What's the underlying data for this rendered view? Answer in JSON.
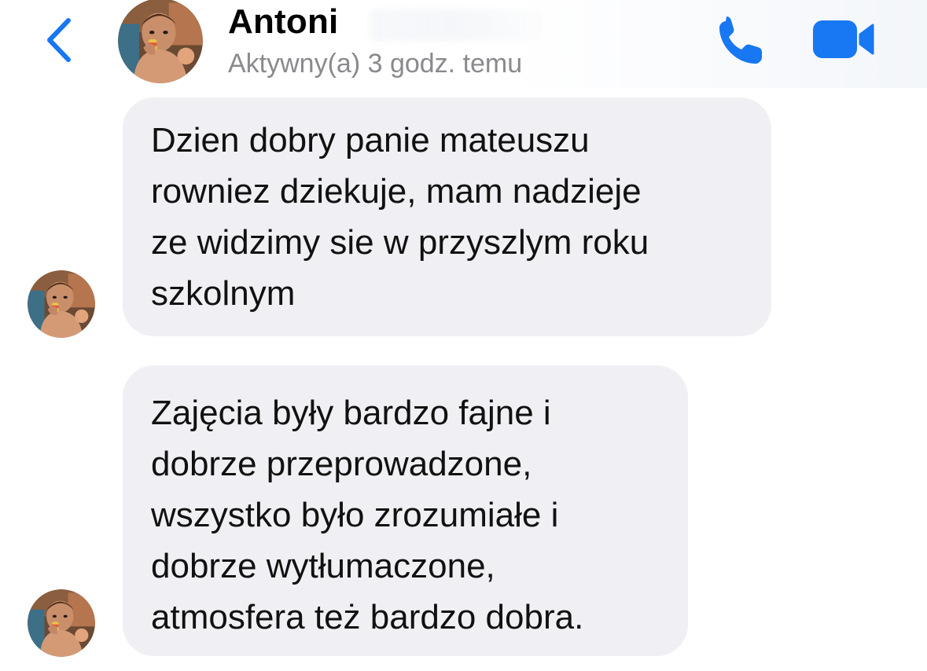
{
  "header": {
    "contact_name": "Antoni",
    "status": "Aktywny(a) 3 godz. temu",
    "back_icon": "chevron-left-icon",
    "call_icon": "phone-icon",
    "video_icon": "video-camera-icon",
    "accent_color": "#1877f2"
  },
  "messages": [
    {
      "lines": [
        "Dzien dobry panie mateuszu",
        "rowniez dziekuje, mam nadzieje",
        "ze widzimy sie w przyszlym roku",
        "szkolnym"
      ]
    },
    {
      "lines": [
        "Zajęcia były bardzo fajne i",
        "dobrze przeprowadzone,",
        "wszystko było zrozumiałe i",
        "dobrze wytłumaczone,",
        "atmosfera też bardzo dobra."
      ]
    }
  ],
  "colors": {
    "bubble_bg": "#f0f0f4",
    "text": "#111111",
    "status_text": "#8a8a8e"
  }
}
